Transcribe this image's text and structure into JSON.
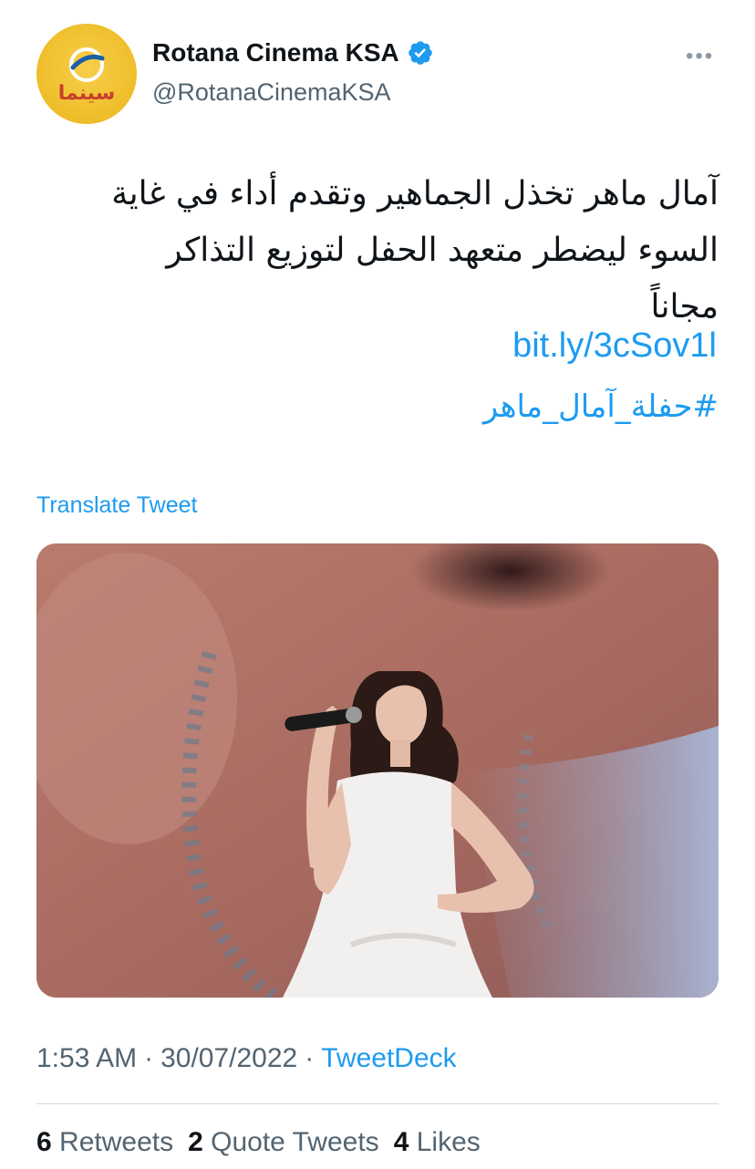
{
  "account": {
    "display_name": "Rotana Cinema KSA",
    "handle": "@RotanaCinemaKSA",
    "avatar_text": "سينما",
    "avatar_color": "#efbd2a"
  },
  "tweet": {
    "text_line1": "آمال ماهر تخذل الجماهير وتقدم أداء في غاية",
    "text_line2": "السوء ليضطر متعهد الحفل لتوزيع التذاكر",
    "text_line3": "مجاناً",
    "link": "bit.ly/3cSov1l",
    "hashtag": "#حفلة_آمال_ماهر",
    "translate_label": "Translate Tweet",
    "time": "1:53 AM",
    "date": "30/07/2022",
    "source": "TweetDeck"
  },
  "stats": {
    "retweets_count": "6",
    "retweets_label": "Retweets",
    "quotes_count": "2",
    "quotes_label": "Quote Tweets",
    "likes_count": "4",
    "likes_label": "Likes"
  },
  "icons": {
    "verified": "verified-badge-icon",
    "more": "more-options-icon"
  },
  "colors": {
    "link": "#1d9bf0",
    "secondary_text": "#536471",
    "primary_text": "#0f1419"
  }
}
